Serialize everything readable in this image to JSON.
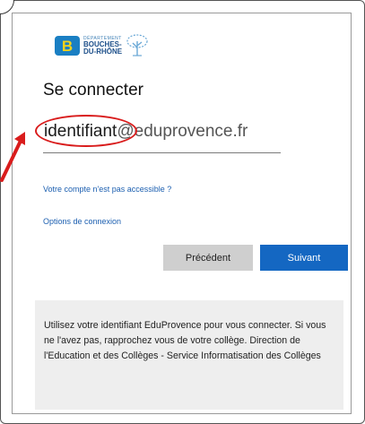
{
  "logo": {
    "letter": "B",
    "line_small": "DÉPARTEMENT",
    "line1": "BOUCHES-",
    "line2": "DU-RHÔNE",
    "icon": "olive-tree-icon",
    "colors": {
      "badge": "#1a7fc3",
      "letter": "#f3d21b",
      "text": "#1d4f8a"
    }
  },
  "signin": {
    "title": "Se connecter",
    "identifier": "identifiant",
    "domain": "@eduprovence.fr"
  },
  "links": {
    "account_inaccessible": "Votre compte n'est pas accessible ?",
    "sign_in_options": "Options de connexion"
  },
  "buttons": {
    "previous": "Précédent",
    "next": "Suivant"
  },
  "info": {
    "text": "Utilisez votre identifiant EduProvence pour vous connecter. Si vous ne l'avez pas, rapprochez vous de votre collège. Direction de l'Education et des Collèges - Service Informatisation des Collèges"
  },
  "annotations": {
    "highlight_color": "#d91c1c",
    "arrow_icon": "red-arrow-icon"
  },
  "colors": {
    "link": "#1c5fb0",
    "primary_button": "#1467c2",
    "secondary_button": "#cfcfcf",
    "info_background": "#eeeeee"
  }
}
